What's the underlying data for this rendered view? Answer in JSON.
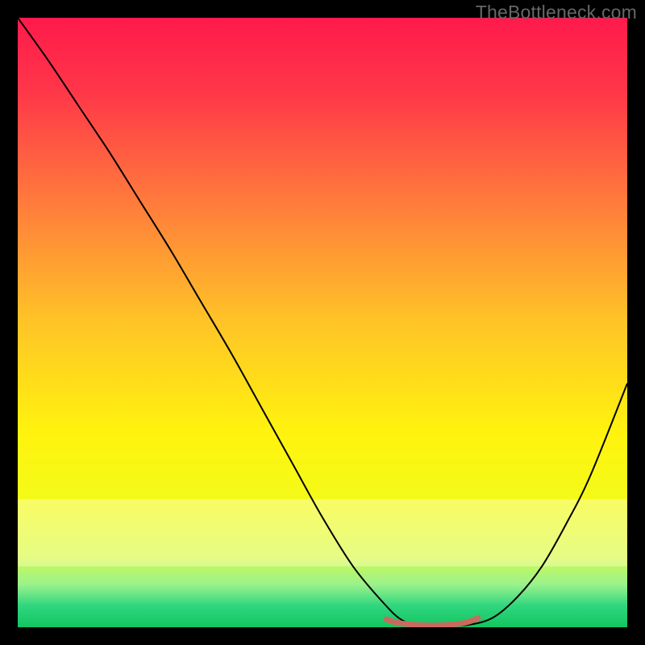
{
  "watermark": "TheBottleneck.com",
  "chart_data": {
    "type": "line",
    "title": "",
    "xlabel": "",
    "ylabel": "",
    "xlim": [
      0,
      100
    ],
    "ylim": [
      0,
      100
    ],
    "grid": false,
    "legend": false,
    "background_gradient": {
      "stops": [
        {
          "offset": 0.0,
          "color": "#ff1a4b"
        },
        {
          "offset": 0.12,
          "color": "#ff3649"
        },
        {
          "offset": 0.3,
          "color": "#ff7a3c"
        },
        {
          "offset": 0.5,
          "color": "#ffc427"
        },
        {
          "offset": 0.68,
          "color": "#fff30e"
        },
        {
          "offset": 0.8,
          "color": "#f3fb1a"
        },
        {
          "offset": 0.88,
          "color": "#d6fb4e"
        },
        {
          "offset": 0.93,
          "color": "#9af28b"
        },
        {
          "offset": 0.965,
          "color": "#2fd67e"
        },
        {
          "offset": 1.0,
          "color": "#13c561"
        }
      ],
      "pale_band": {
        "y_top_pct": 79,
        "y_bot_pct": 90,
        "color": "#fdfdc4",
        "opacity": 0.45
      }
    },
    "series": [
      {
        "name": "bottleneck-curve",
        "stroke": "#000000",
        "stroke_width": 2,
        "x": [
          0,
          5,
          10,
          15,
          20,
          25,
          30,
          35,
          40,
          45,
          50,
          55,
          60,
          63,
          66,
          70,
          74,
          78,
          82,
          86,
          90,
          94,
          100
        ],
        "y": [
          100,
          93,
          85.5,
          78,
          70,
          62,
          53.5,
          45,
          36,
          27,
          18,
          10,
          4,
          1.2,
          0.4,
          0.2,
          0.4,
          1.6,
          5,
          10,
          17,
          25,
          40
        ]
      }
    ],
    "marker_segment": {
      "name": "optimal-range",
      "stroke": "#c96a5f",
      "stroke_width": 7,
      "x": [
        60.5,
        62,
        64,
        66,
        68,
        70,
        72,
        74,
        75.5
      ],
      "y": [
        1.3,
        0.8,
        0.5,
        0.35,
        0.3,
        0.35,
        0.5,
        0.9,
        1.5
      ]
    }
  }
}
